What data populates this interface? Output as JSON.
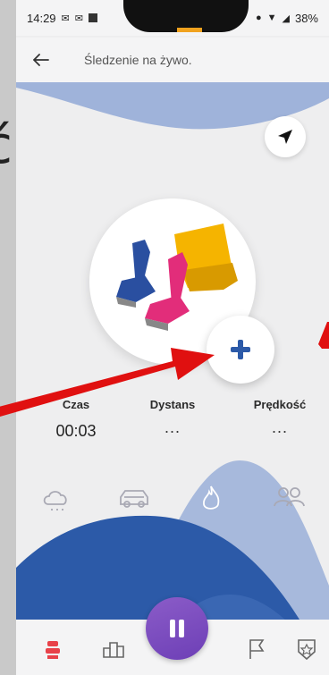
{
  "status_bar": {
    "time": "14:29",
    "battery": "38%"
  },
  "app_bar": {
    "title": "Śledzenie na żywo."
  },
  "overlay": {
    "partial_char": "ć"
  },
  "stats": [
    {
      "label": "Czas",
      "value": "00:03"
    },
    {
      "label": "Dystans",
      "value": "..."
    },
    {
      "label": "Prędkość",
      "value": "..."
    }
  ],
  "icons": {
    "row": [
      "weather-icon",
      "car-icon",
      "fire-icon",
      "people-icon"
    ],
    "nav": [
      "seat-nav-icon",
      "trophy-nav-icon",
      "pause-icon",
      "flag-nav-icon",
      "badge-nav-icon"
    ]
  },
  "colors": {
    "accent_blue": "#2c5aa8",
    "light_blue": "#9fb3da",
    "pause_purple": "#7a4bbf",
    "arrow_red": "#e01010",
    "active_nav": "#e8424a"
  }
}
